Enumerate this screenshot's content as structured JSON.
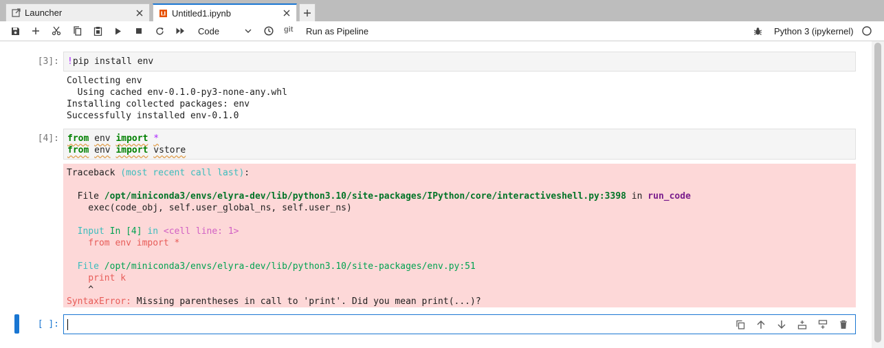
{
  "tabs": {
    "launcher": {
      "label": "Launcher",
      "icon": "launcher-icon"
    },
    "notebook": {
      "label": "Untitled1.ipynb",
      "icon": "notebook-icon",
      "icon_color": "#e65100"
    },
    "add_label": "+"
  },
  "toolbar": {
    "cell_type": "Code",
    "git_label": "git",
    "pipeline_label": "Run as Pipeline",
    "kernel_name": "Python 3 (ipykernel)",
    "accent_color": "#1976d2"
  },
  "cells": {
    "cell1": {
      "prompt": "[3]:",
      "bang": "!",
      "code": "pip install env",
      "output": [
        "Collecting env",
        "  Using cached env-0.1.0-py3-none-any.whl",
        "Installing collected packages: env",
        "Successfully installed env-0.1.0"
      ]
    },
    "cell2": {
      "prompt": "[4]:",
      "line1": {
        "kw1": "from",
        "mod": "env",
        "kw2": "import",
        "name": "*"
      },
      "line2": {
        "kw1": "from",
        "mod": "env",
        "kw2": "import",
        "name": "vstore"
      },
      "traceback": {
        "header": "Traceback",
        "header_paren": "(most recent call last)",
        "header_colon": ":",
        "file1_prefix": "  File ",
        "file1_path": "/opt/miniconda3/envs/elyra-dev/lib/python3.10/site-packages/IPython/core/interactiveshell.py:3398",
        "file1_in": " in ",
        "file1_fn": "run_code",
        "file1_code": "    exec(code_obj, self.user_global_ns, self.user_ns)",
        "input_label": "  Input",
        "input_in4": "In [4]",
        "input_in": " in ",
        "input_loc": "<cell line: 1>",
        "input_code": "    from env import *",
        "file2_label": "  File",
        "file2_path": "/opt/miniconda3/envs/elyra-dev/lib/python3.10/site-packages/env.py:51",
        "file2_code": "    print k",
        "caret": "    ^",
        "error_name": "SyntaxError:",
        "error_msg": " Missing parentheses in call to 'print'. Did you mean print(...)?"
      },
      "error_bg": "#fdd8d8"
    },
    "cell3": {
      "prompt": "[ ]:"
    }
  }
}
